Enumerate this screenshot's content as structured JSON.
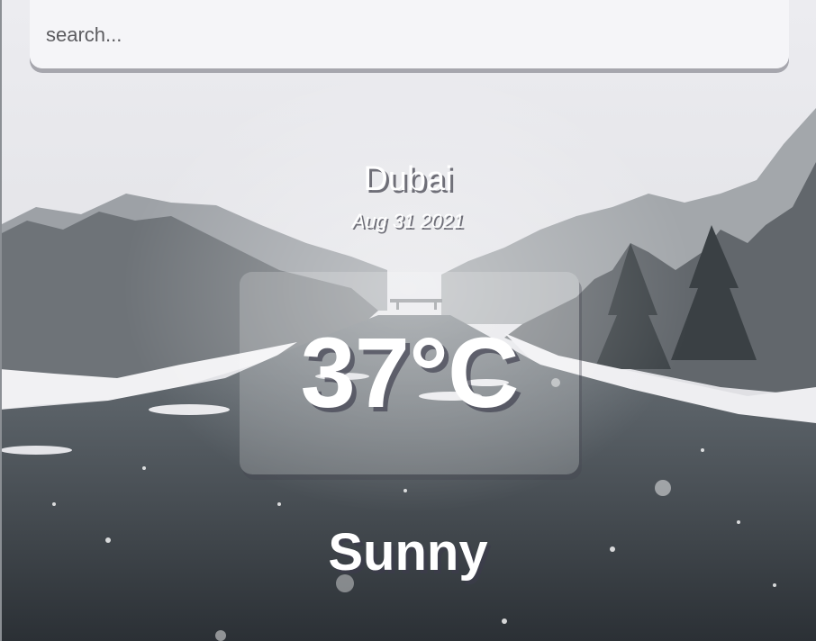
{
  "search": {
    "placeholder": "search...",
    "value": ""
  },
  "location": {
    "city": "Dubai",
    "date": "Aug 31 2021"
  },
  "weather": {
    "temperature": "37°C",
    "condition": "Sunny"
  },
  "background": {
    "scene": "snowy-river-landscape"
  }
}
